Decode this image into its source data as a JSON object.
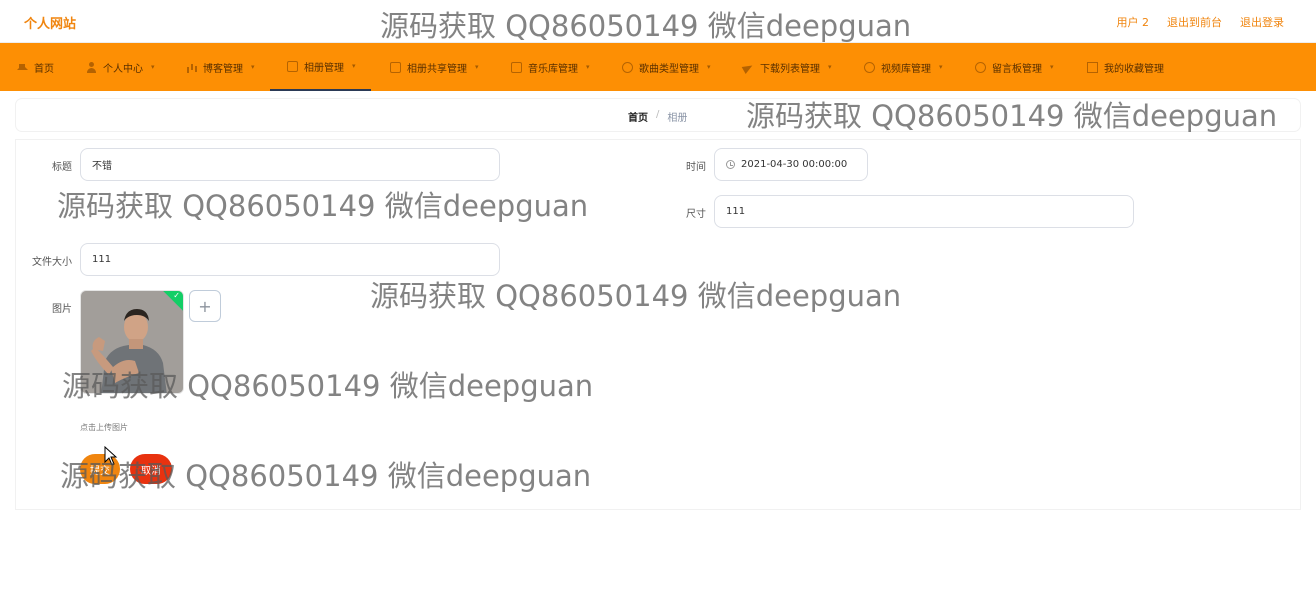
{
  "header": {
    "site_title": "个人网站",
    "user_label": "用户 2",
    "front_link": "退出到前台",
    "logout_link": "退出登录"
  },
  "nav": [
    {
      "label": "首页",
      "icon": "home-icon",
      "has_caret": false
    },
    {
      "label": "个人中心",
      "icon": "user-icon",
      "has_caret": true
    },
    {
      "label": "博客管理",
      "icon": "bar-chart-icon",
      "has_caret": true
    },
    {
      "label": "相册管理",
      "icon": "album-icon",
      "has_caret": true,
      "active": true
    },
    {
      "label": "相册共享管理",
      "icon": "share-icon",
      "has_caret": true
    },
    {
      "label": "音乐库管理",
      "icon": "music-icon",
      "has_caret": true
    },
    {
      "label": "歌曲类型管理",
      "icon": "circle-icon",
      "has_caret": true
    },
    {
      "label": "下载列表管理",
      "icon": "plane-icon",
      "has_caret": true
    },
    {
      "label": "视频库管理",
      "icon": "video-icon",
      "has_caret": true
    },
    {
      "label": "留言板管理",
      "icon": "power-icon",
      "has_caret": true
    },
    {
      "label": "我的收藏管理",
      "icon": "doc-icon",
      "has_caret": false
    }
  ],
  "breadcrumb": {
    "home": "首页",
    "separator": "/",
    "current": "相册"
  },
  "form": {
    "title_label": "标题",
    "title_value": "不错",
    "time_label": "时间",
    "time_value": "2021-04-30 00:00:00",
    "size_label": "尺寸",
    "size_value": "111",
    "filesize_label": "文件大小",
    "filesize_value": "111",
    "image_label": "图片",
    "upload_tip": "点击上传图片",
    "add_symbol": "+",
    "submit_label": "提交",
    "cancel_label": "取消"
  },
  "watermark": "源码获取 QQ86050149 微信deepguan",
  "colors": {
    "accent": "#fd8f04",
    "brand_text": "#f0850f",
    "cancel": "#e8320f",
    "success": "#13ce66"
  }
}
